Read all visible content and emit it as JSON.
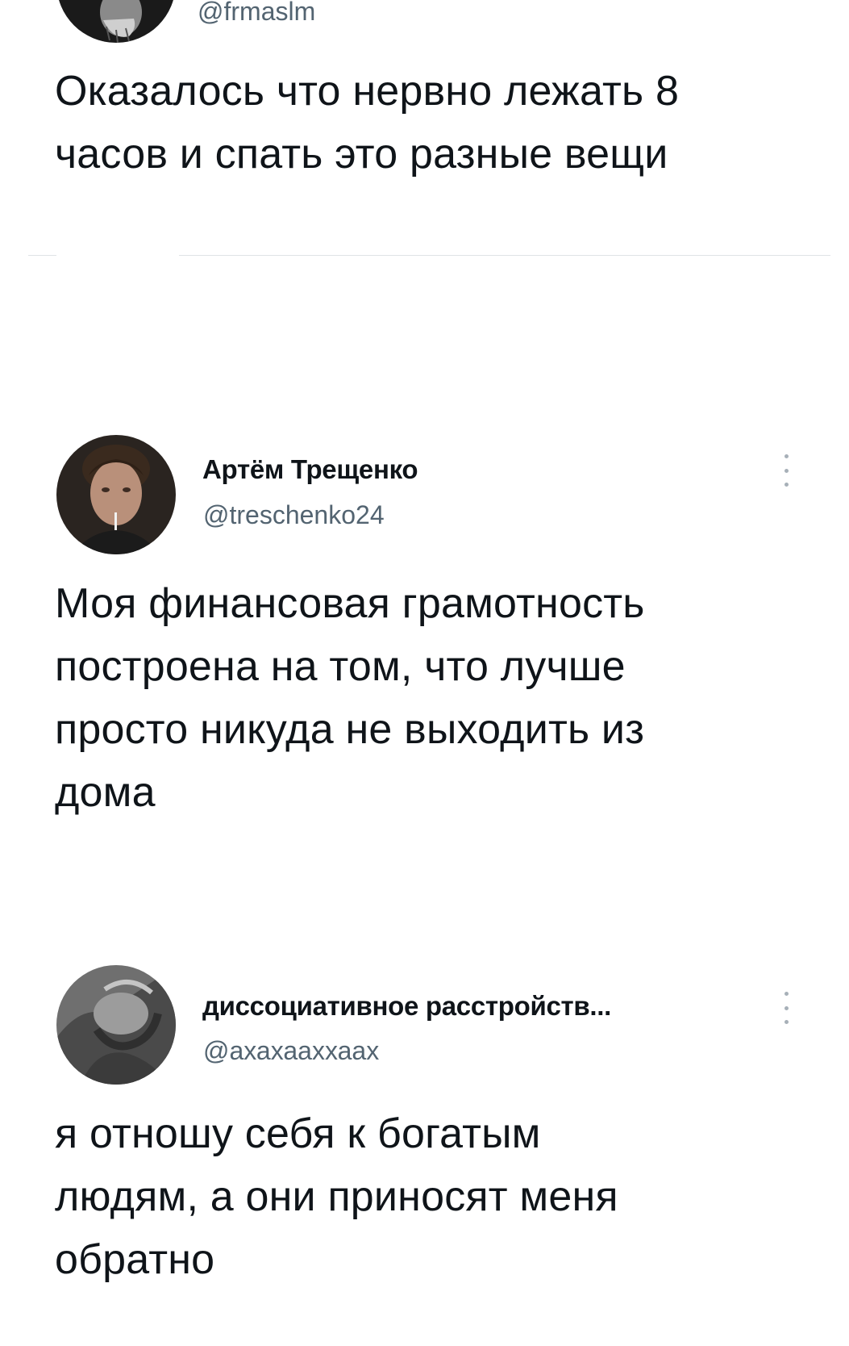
{
  "tweets": [
    {
      "display_name": "",
      "handle": "@frmaslm",
      "text": "Оказалось что нервно лежать 8\nчасов и спать это разные вещи",
      "avatar_icon": "avatar-photo-icon"
    },
    {
      "display_name": "Артём Трещенко",
      "handle": "@treschenko24",
      "text": "Моя финансовая грамотность\nпостроена на том, что лучше\nпросто никуда не выходить из\nдома",
      "avatar_icon": "avatar-photo-icon"
    },
    {
      "display_name": "диссоциативное расстройств...",
      "handle": "@ахахааххаах",
      "text": "я отношу себя к богатым\nлюдям, а они приносят меня\nобратно",
      "avatar_icon": "avatar-photo-icon"
    }
  ],
  "colors": {
    "text": "#0f1419",
    "secondary": "#536471",
    "divider": "#dfe3e6"
  },
  "icons": {
    "more": "more-vertical-icon"
  }
}
